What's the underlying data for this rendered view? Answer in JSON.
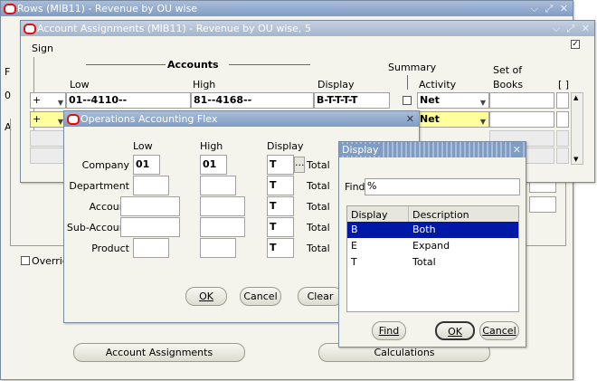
{
  "rows_window": {
    "title": "Rows (MIB11) - Revenue by OU wise",
    "override_label": "Override",
    "account_assignments_button": "Account Assignments",
    "calculations_button": "Calculations",
    "frag_f": "F",
    "frag_a": "A",
    "frag_0": "0"
  },
  "assign_window": {
    "title": "Account Assignments (MIB11) - Revenue by OU wise, 5",
    "sign_label": "Sign",
    "accounts_label": "Accounts",
    "low_label": "Low",
    "high_label": "High",
    "display_label": "Display",
    "summary_label": "Summary",
    "activity_label": "Activity",
    "set_of_label": "Set of",
    "books_label": "Books",
    "bracket_label": "[ ]",
    "rows": [
      {
        "sign": "+",
        "low": "01--4110--",
        "high": "81--4168--",
        "display": "B-T-T-T-T",
        "activity": "Net"
      },
      {
        "sign": "+",
        "low": "",
        "high": "",
        "display": "",
        "activity": "Net"
      }
    ]
  },
  "flex_window": {
    "title": "Operations Accounting Flex",
    "low_header": "Low",
    "high_header": "High",
    "display_header": "Display",
    "segments": [
      {
        "label": "Company",
        "low": "01",
        "high": "01",
        "display": "T",
        "total": "Total"
      },
      {
        "label": "Department",
        "low": "",
        "high": "",
        "display": "T",
        "total": "Total"
      },
      {
        "label": "Account",
        "low": "",
        "high": "",
        "display": "T",
        "total": "Total"
      },
      {
        "label": "Sub-Account",
        "low": "",
        "high": "",
        "display": "T",
        "total": "Total"
      },
      {
        "label": "Product",
        "low": "",
        "high": "",
        "display": "T",
        "total": "Total"
      }
    ],
    "ok_button": "OK",
    "cancel_button": "Cancel",
    "clear_button": "Clear",
    "lov_button": "..."
  },
  "display_lov": {
    "title": "Display",
    "find_label": "Find",
    "find_value": "%",
    "col_display": "Display",
    "col_description": "Description",
    "items": [
      {
        "code": "B",
        "desc": "Both"
      },
      {
        "code": "E",
        "desc": "Expand"
      },
      {
        "code": "T",
        "desc": "Total"
      }
    ],
    "find_button": "Find",
    "ok_button": "OK",
    "cancel_button": "Cancel"
  }
}
